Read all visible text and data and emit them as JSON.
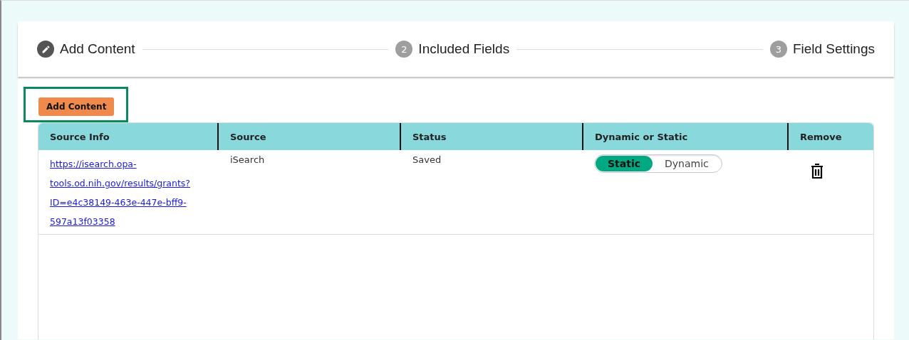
{
  "stepper": {
    "steps": [
      {
        "label": "Add Content",
        "active": true
      },
      {
        "label": "Included Fields",
        "number": "2",
        "active": false
      },
      {
        "label": "Field Settings",
        "number": "3",
        "active": false
      }
    ]
  },
  "add_button": {
    "label": "Add Content",
    "highlighted": true
  },
  "table": {
    "columns": [
      "Source Info",
      "Source",
      "Status",
      "Dynamic or Static",
      "Remove"
    ],
    "rows": [
      {
        "source_info": "https://isearch.opa-tools.od.nih.gov/results/grants?ID=e4c38149-463e-447e-bff9-597a13f03358",
        "source": "iSearch",
        "status": "Saved",
        "mode_options": [
          {
            "label": "Static",
            "selected": true
          },
          {
            "label": "Dynamic",
            "selected": false
          }
        ]
      }
    ]
  }
}
